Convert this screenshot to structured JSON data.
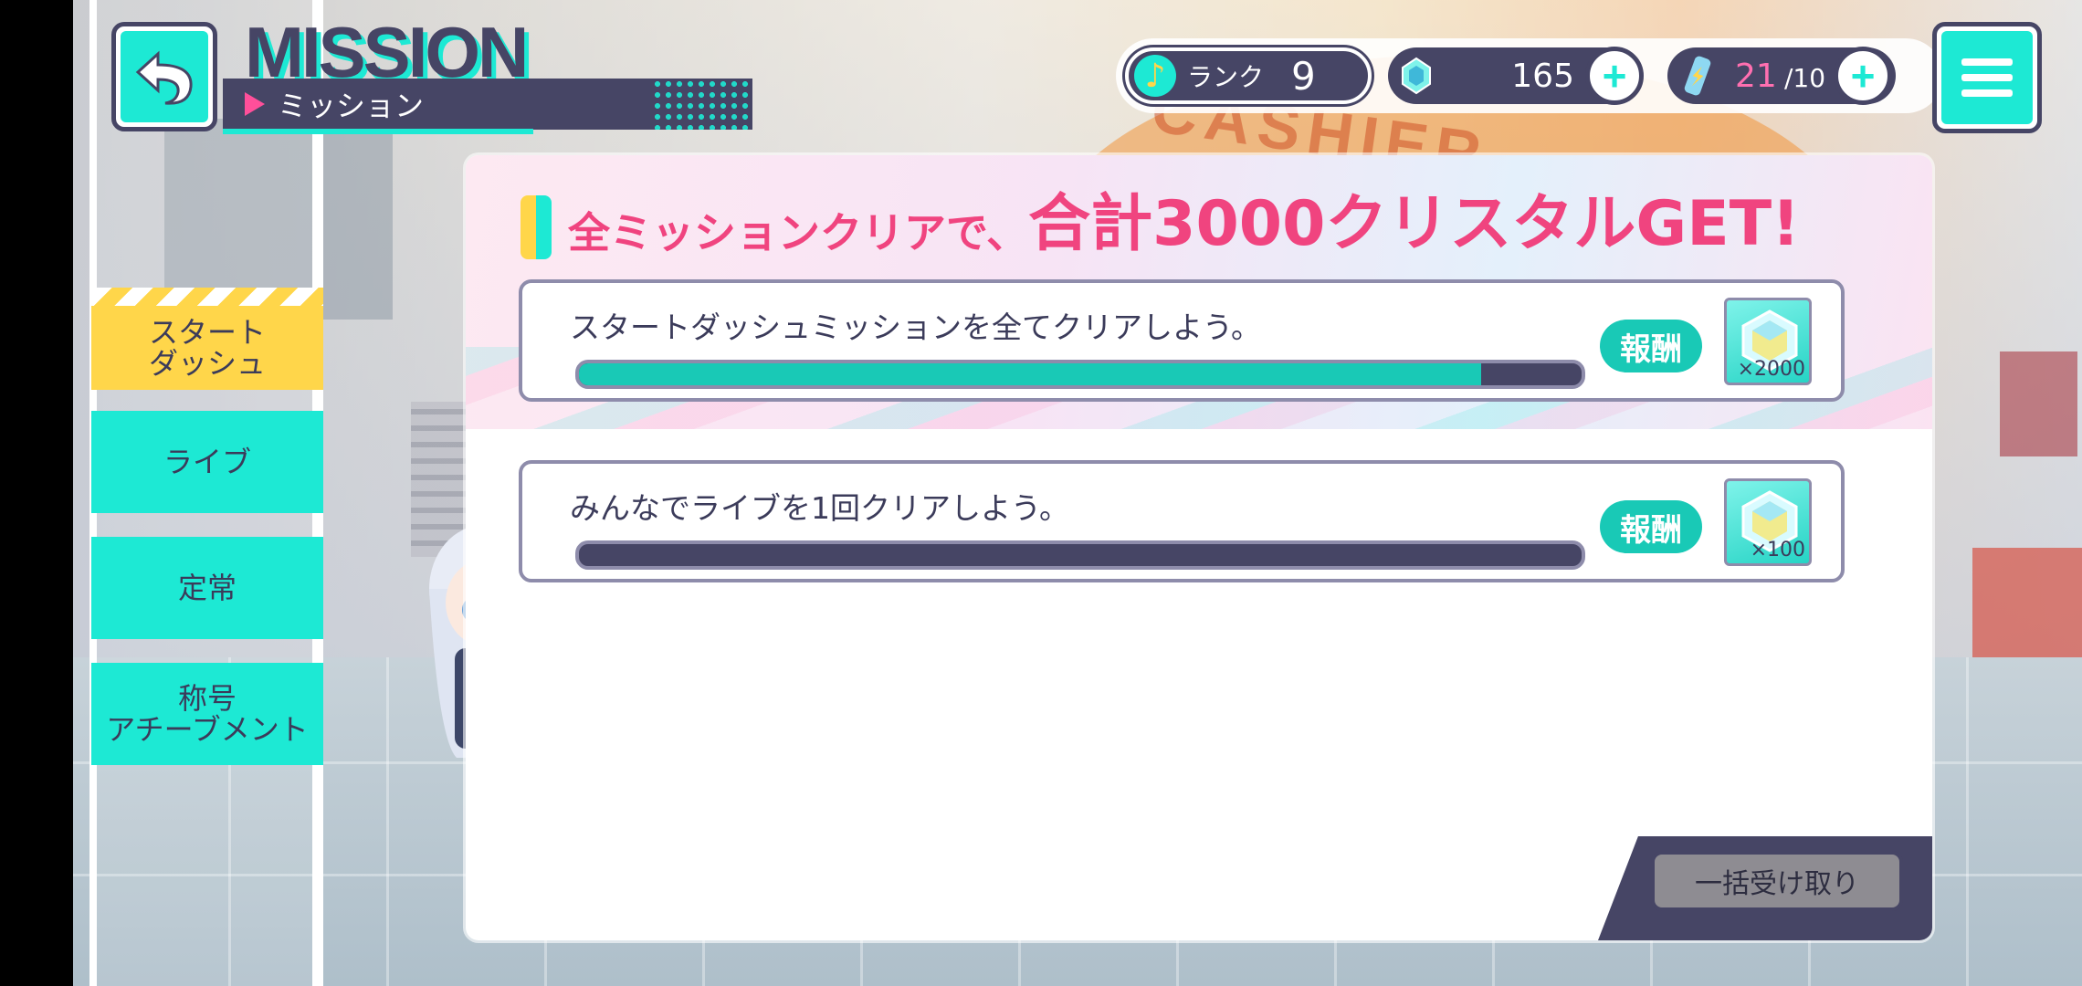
{
  "header": {
    "title_en": "MISSION",
    "title_jp": "ミッション"
  },
  "status": {
    "rank_label": "ランク",
    "rank_value": "9",
    "crystals": "165",
    "energy_current": "21",
    "energy_max": "/10"
  },
  "sidebar": {
    "items": [
      {
        "label_line1": "スタート",
        "label_line2": "ダッシュ",
        "active": true
      },
      {
        "label_line1": "ライブ",
        "label_line2": "",
        "active": false
      },
      {
        "label_line1": "定常",
        "label_line2": "",
        "active": false
      },
      {
        "label_line1": "称号",
        "label_line2": "アチーブメント",
        "active": false
      }
    ]
  },
  "banner": {
    "part1": "全ミッションクリアで、",
    "part2": "合計3000クリスタルGET",
    "part3": "!"
  },
  "missions": [
    {
      "text": "スタートダッシュミッションを全てクリアしよう。",
      "progress": 0.9,
      "reward_label": "報酬",
      "reward_qty": "×2000"
    },
    {
      "text": "みんなでライブを1回クリアしよう。",
      "progress": 0.0,
      "reward_label": "報酬",
      "reward_qty": "×100"
    }
  ],
  "footer": {
    "claim_all_label": "一括受け取り"
  },
  "colors": {
    "accent_cyan": "#1de9d4",
    "navy": "#464565",
    "active_tab": "#ffd64a",
    "banner_pink": "#f0447f",
    "progress_fill": "#19c9b6"
  },
  "icons": {
    "back": "back-arrow-icon",
    "menu": "hamburger-menu-icon",
    "rank": "music-note-icon",
    "crystal": "crystal-icon",
    "energy": "energy-bottle-icon"
  }
}
